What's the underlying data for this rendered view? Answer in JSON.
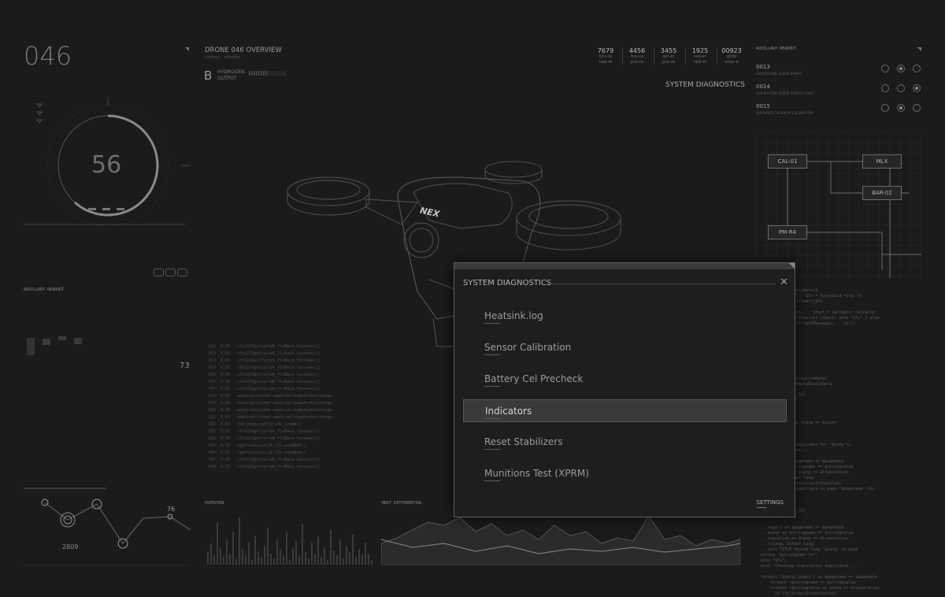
{
  "left_panel": {
    "drone_number": "046",
    "gauge_value": "56",
    "aux_title": "AUXILLARY READOUT",
    "aux_value": "73",
    "graph_value_a": "76",
    "graph_value_b": "2809"
  },
  "header": {
    "title": "DRONE 046 OVERVIEW",
    "subtitle": "status: standby",
    "hydrogen_letter": "B",
    "hydrogen_label_1": "HYDROGEN",
    "hydrogen_label_2": "OUTPUT",
    "system_diagnostics_link": "SYSTEM DIAGNOSTICS",
    "stats": [
      {
        "value": "7679",
        "sub1": "bra-la",
        "sub2": "vad-ei"
      },
      {
        "value": "4456",
        "sub1": "bra-la",
        "sub2": "pro-ro"
      },
      {
        "value": "3455",
        "sub1": "sel-er",
        "sub2": "pro-ro"
      },
      {
        "value": "1925",
        "sub1": "sel-er",
        "sub2": "tad-ei"
      },
      {
        "value": "00923",
        "sub1": "gtdo",
        "sub2": "wiso-a"
      }
    ]
  },
  "right_panel": {
    "aux_title": "AUXILLARY READOUT",
    "rows": [
      {
        "id": "0013",
        "sub": "SUB-ROUTINE QUERY BINARY"
      },
      {
        "id": "0014",
        "sub": "SUB-ROUTINE QUERY SYNTAX FLOW"
      },
      {
        "id": "0015",
        "sub": "DIAGNOSTIC NODE BY CALIBRATION"
      }
    ],
    "nodes": {
      "cal": "CAL-01",
      "mlx": "MLX",
      "bar": "BAR-02",
      "pm": "PM-R4"
    }
  },
  "bottom": {
    "overview_label": "OVERVIEW",
    "heat_label": "HEAT DIFFERENTIAL"
  },
  "modal": {
    "title": "SYSTEM DIAGNOSTICS",
    "items": [
      "Heatsink.log",
      "Sensor Calibration",
      "Battery Cel Precheck",
      "Indicators",
      "Reset Stabilizers",
      "Munitions Test (XPRM)"
    ],
    "selected_index": 3,
    "settings_label": "SETTINGS"
  },
  "colors": {
    "background": "#1b1b1b",
    "panel_line": "#3b3b3b",
    "highlight": "#3a3a3a",
    "text": "#8e8e8e"
  }
}
